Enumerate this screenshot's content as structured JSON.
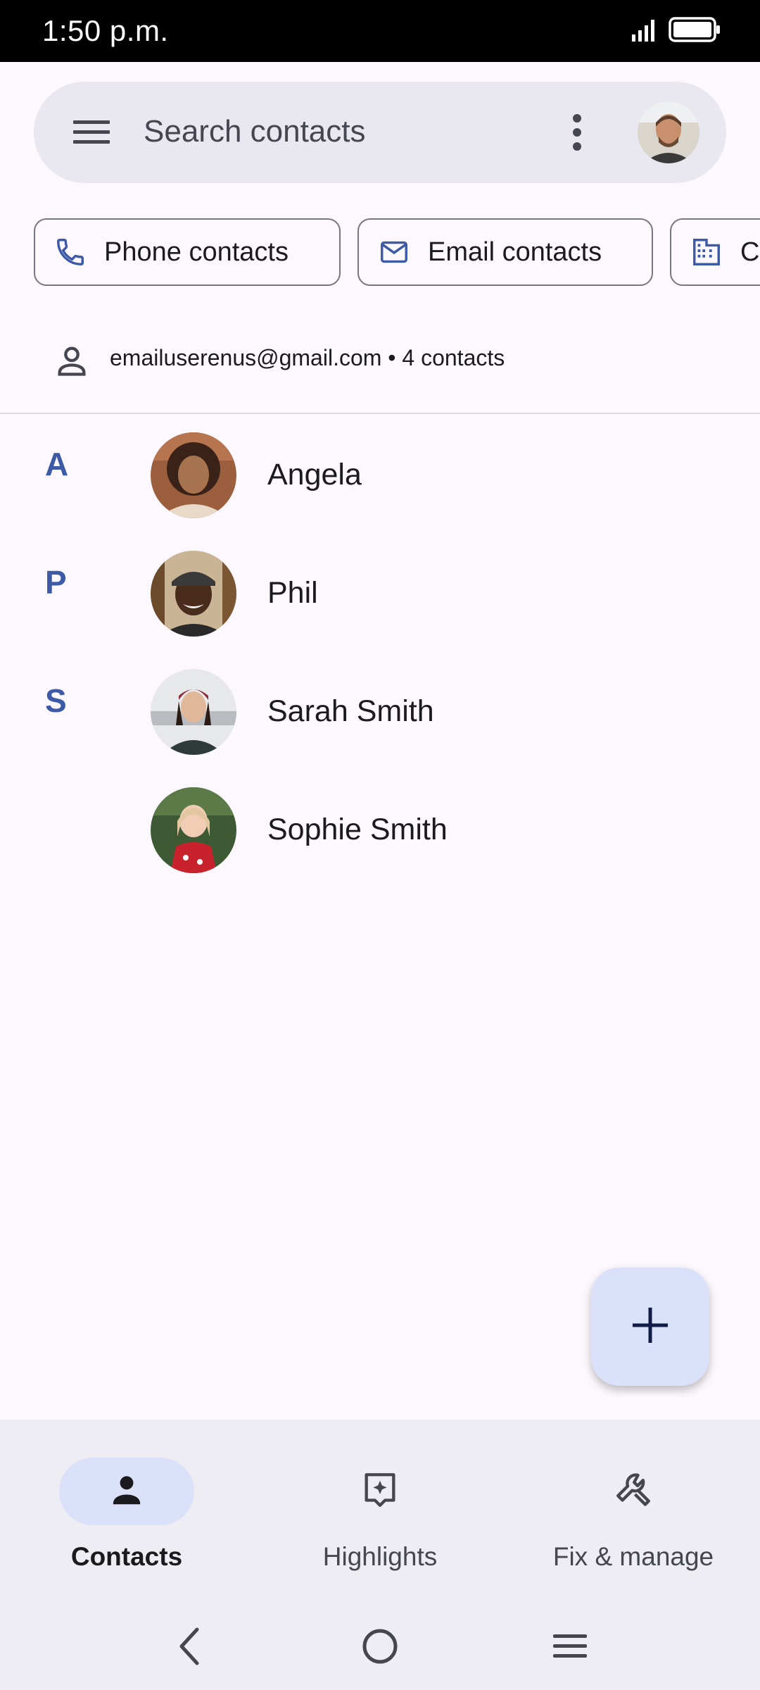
{
  "status_bar": {
    "time": "1:50 p.m."
  },
  "search": {
    "placeholder": "Search contacts",
    "icons": [
      "menu-icon",
      "more-vert-icon",
      "account-avatar"
    ]
  },
  "chips": [
    {
      "label": "Phone contacts",
      "icon": "phone-icon"
    },
    {
      "label": "Email contacts",
      "icon": "email-icon"
    },
    {
      "label": "C",
      "icon": "building-icon"
    }
  ],
  "account": {
    "summary": "emailuserenus@gmail.com • 4 contacts",
    "icon": "person-outline-icon"
  },
  "contacts": [
    {
      "letter": "A",
      "name": "Angela"
    },
    {
      "letter": "P",
      "name": "Phil"
    },
    {
      "letter": "S",
      "name": "Sarah Smith"
    },
    {
      "letter": "",
      "name": "Sophie Smith"
    }
  ],
  "fab": {
    "icon": "plus-icon"
  },
  "bottom_nav": [
    {
      "label": "Contacts",
      "icon": "person-filled-icon",
      "active": true
    },
    {
      "label": "Highlights",
      "icon": "highlights-icon",
      "active": false
    },
    {
      "label": "Fix & manage",
      "icon": "wrench-icon",
      "active": false
    }
  ],
  "system_nav": [
    "back-icon",
    "home-icon",
    "recents-icon"
  ],
  "colors": {
    "accent": "#3d5aa6",
    "background": "#fdf8fd",
    "search_bar": "#e9e8f1",
    "nav_background": "#eeedf4",
    "active_pill": "#dce1fa"
  }
}
